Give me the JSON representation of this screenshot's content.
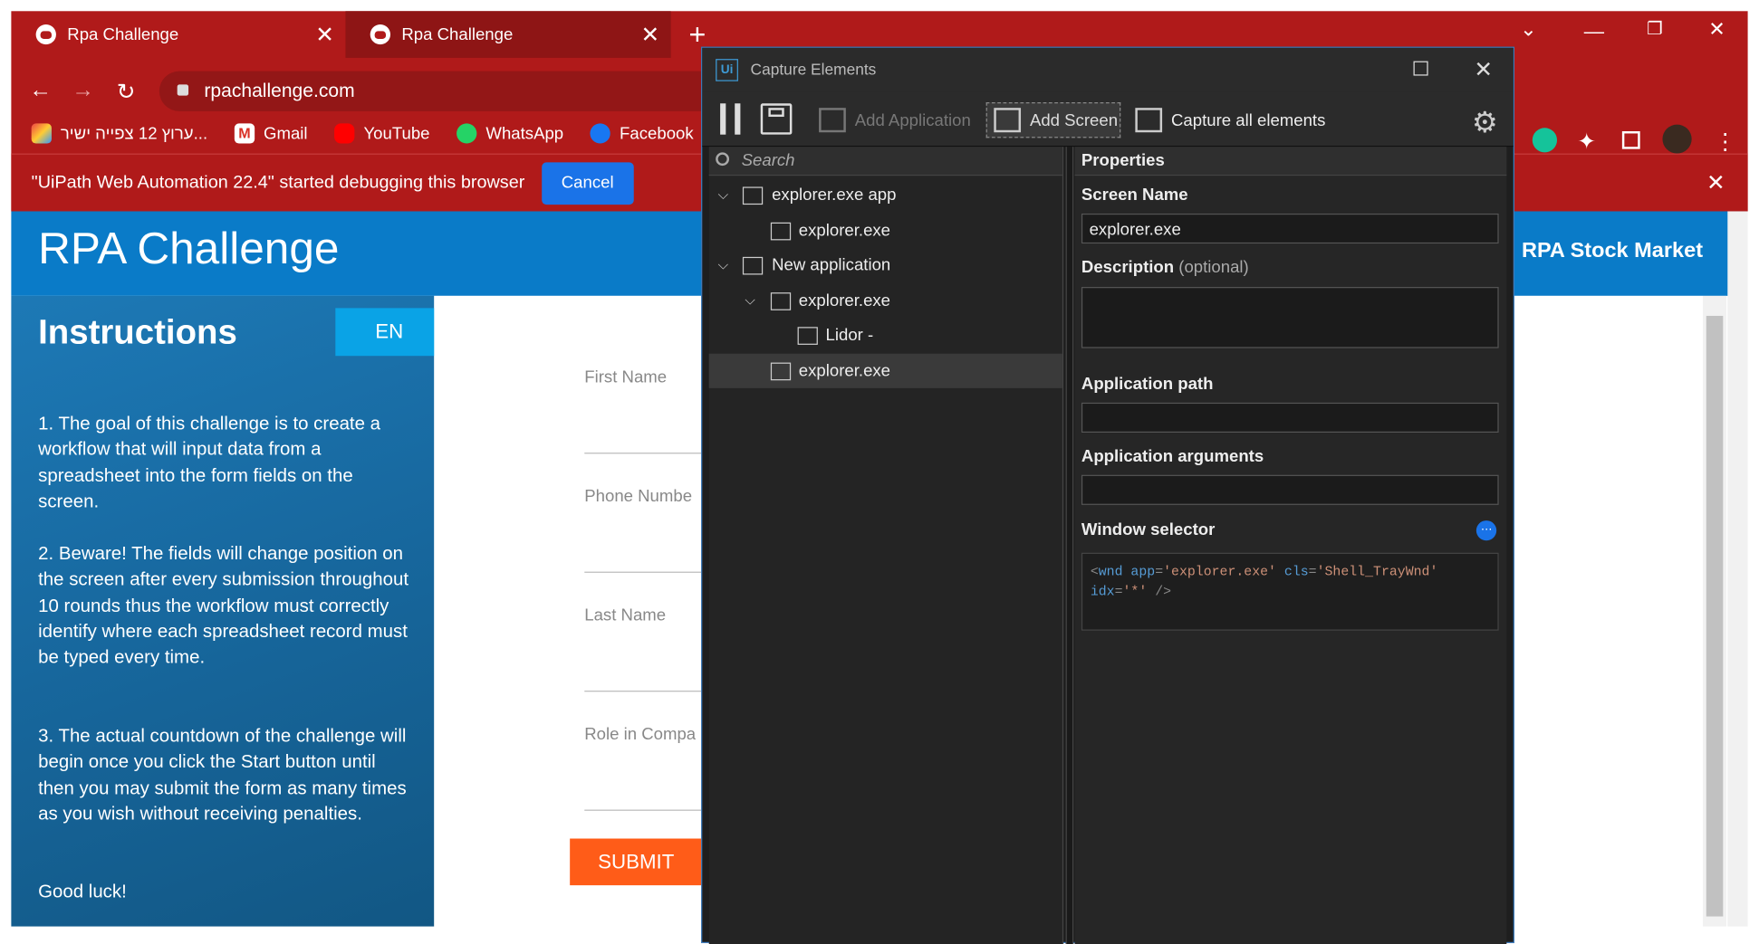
{
  "browser": {
    "tabs": [
      {
        "title": "Rpa Challenge"
      },
      {
        "title": "Rpa Challenge"
      }
    ],
    "address": "rpachallenge.com",
    "bookmarks": [
      {
        "label": "ערוץ 12 צפייה ישיר...",
        "icon": "tv-icon"
      },
      {
        "label": "Gmail",
        "icon": "gmail-icon"
      },
      {
        "label": "YouTube",
        "icon": "youtube-icon"
      },
      {
        "label": "WhatsApp",
        "icon": "whatsapp-icon"
      },
      {
        "label": "Facebook",
        "icon": "facebook-icon"
      }
    ],
    "debug_message": "\"UiPath Web Automation 22.4\" started debugging this browser",
    "cancel_label": "Cancel",
    "accent": "#b01a1a"
  },
  "page": {
    "brand": "RPA Challenge",
    "stock_link": "RPA Stock Market",
    "instructions_title": "Instructions",
    "lang_button": "EN",
    "paragraphs": [
      "1. The goal of this challenge is to create a workflow that will input data from a spreadsheet into the form fields on the screen.",
      "2. Beware! The fields will change position on the screen after every submission throughout 10 rounds thus the workflow must correctly identify where each spreadsheet record must be typed every time.",
      "3. The actual countdown of the challenge will begin once you click the Start button until then you may submit the form as many times as you wish without receiving penalties.",
      "Good luck!"
    ],
    "form_labels": [
      "First Name",
      "Phone Numbe",
      "Last Name",
      "Role in Compa"
    ],
    "submit_label": "SUBMIT"
  },
  "capture": {
    "title": "Capture Elements",
    "toolbar": {
      "add_application": "Add Application",
      "add_screen": "Add Screen",
      "capture_all": "Capture all elements"
    },
    "search_placeholder": "Search",
    "tree": [
      {
        "label": "explorer.exe app",
        "level": 0,
        "expanded": true,
        "selected": false
      },
      {
        "label": "explorer.exe",
        "level": 1,
        "expanded": false,
        "selected": false
      },
      {
        "label": "New application",
        "level": 0,
        "expanded": true,
        "selected": false
      },
      {
        "label": "explorer.exe",
        "level": 1,
        "expanded": true,
        "selected": false
      },
      {
        "label": "Lidor -",
        "level": 2,
        "expanded": false,
        "selected": false
      },
      {
        "label": "explorer.exe",
        "level": 1,
        "expanded": false,
        "selected": true
      }
    ],
    "properties": {
      "header": "Properties",
      "screen_name_label": "Screen Name",
      "screen_name_value": "explorer.exe",
      "description_label": "Description",
      "description_optional": "(optional)",
      "app_path_label": "Application path",
      "app_args_label": "Application arguments",
      "window_selector_label": "Window selector",
      "selector": {
        "tag": "wnd",
        "app": "'explorer.exe'",
        "cls": "'Shell_TrayWnd'",
        "idx": "'*'"
      }
    }
  }
}
